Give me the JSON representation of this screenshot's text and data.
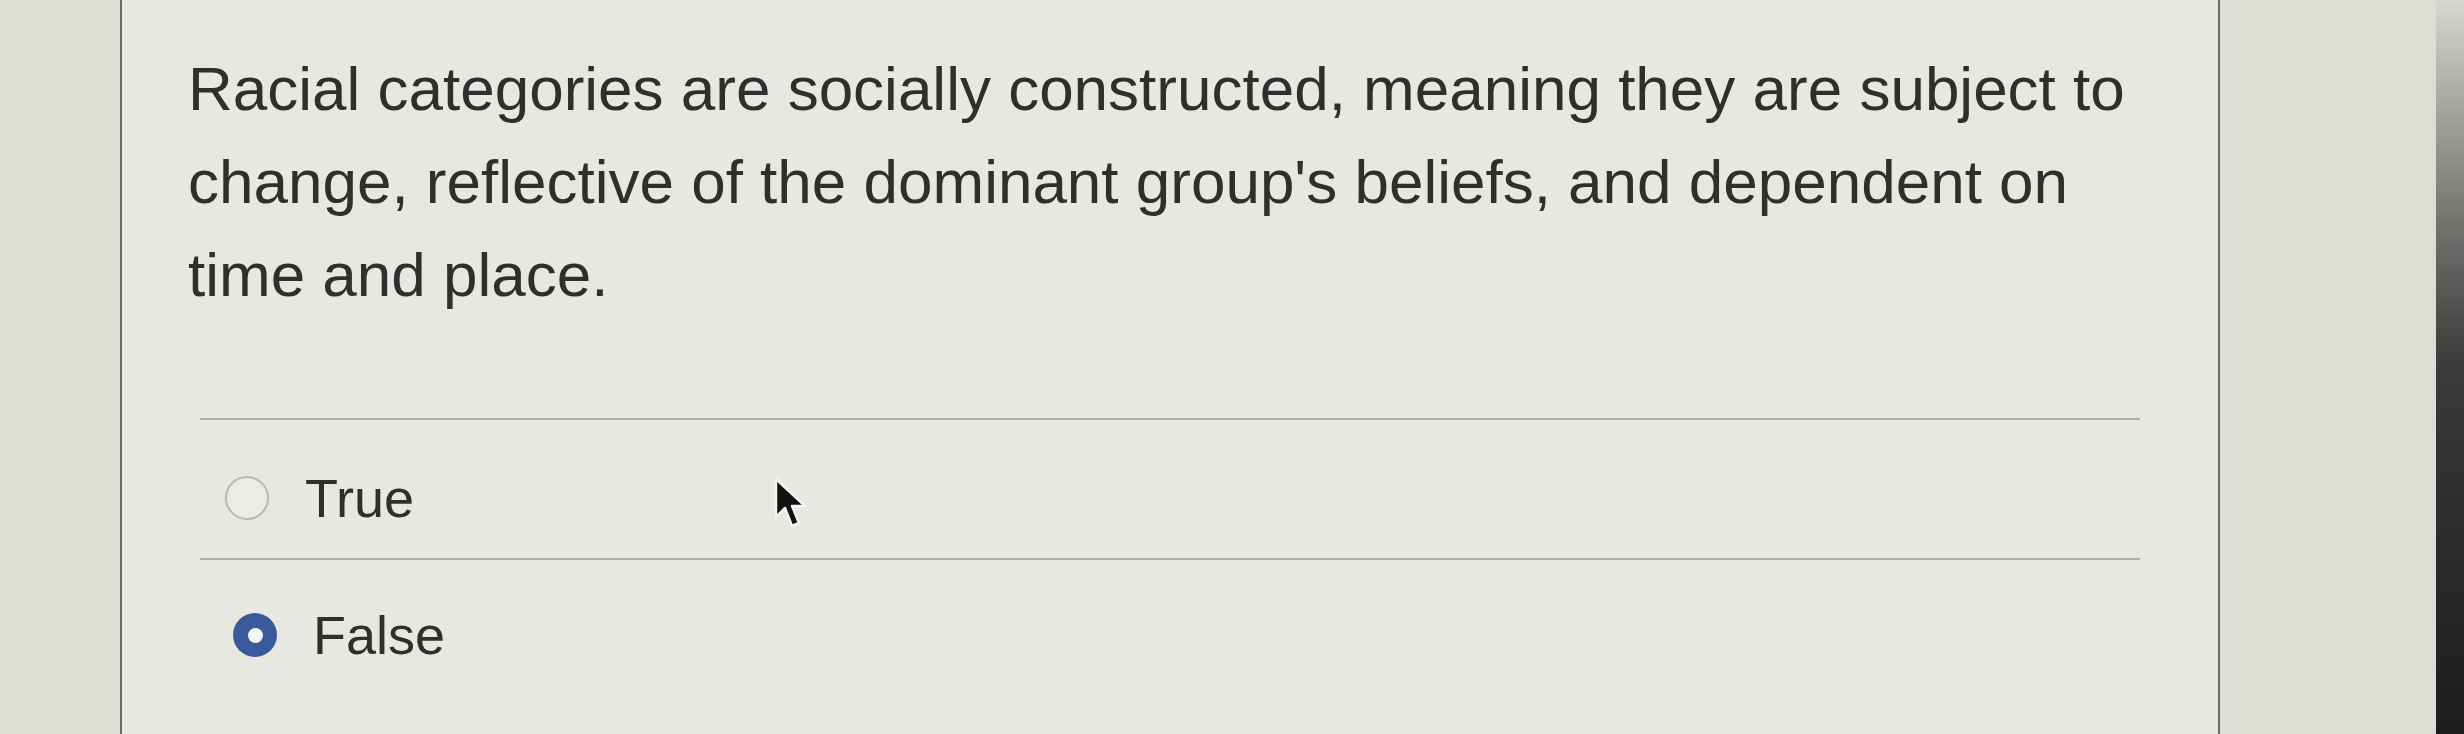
{
  "question": {
    "text": "Racial categories are socially constructed, meaning they are subject to change, reflective of the dominant group's beliefs, and dependent on time and place."
  },
  "options": [
    {
      "label": "True",
      "selected": false
    },
    {
      "label": "False",
      "selected": true
    }
  ]
}
